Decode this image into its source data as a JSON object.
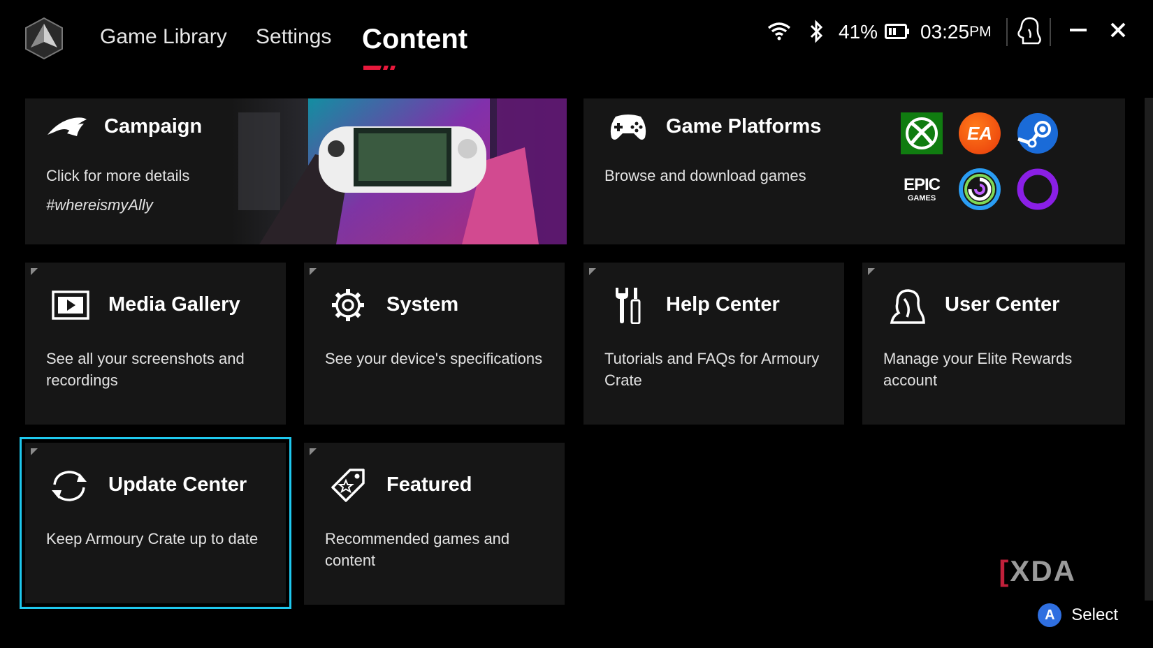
{
  "header": {
    "tabs": [
      {
        "label": "Game Library",
        "active": false
      },
      {
        "label": "Settings",
        "active": false
      },
      {
        "label": "Content",
        "active": true
      }
    ],
    "status": {
      "battery": "41%",
      "time": "03:25",
      "ampm": "PM"
    },
    "icons": [
      "rog-logo-icon",
      "wifi-icon",
      "bluetooth-icon",
      "battery-icon",
      "user-icon",
      "minimize-icon",
      "close-icon"
    ],
    "accent_color": "#e8193c"
  },
  "cards": {
    "campaign": {
      "title": "Campaign",
      "desc": "Click for more details",
      "hashtag": "#whereismyAlly",
      "icon": "rog-eye-icon"
    },
    "platforms": {
      "title": "Game Platforms",
      "desc": "Browse and download games",
      "icon": "gamepad-icon",
      "logos": {
        "xbox": "xbox-logo",
        "ea": "EA",
        "steam": "steam-logo",
        "epic_line1": "EPIC",
        "epic_line2": "GAMES",
        "ubisoft": "ubisoft-logo",
        "gog": "gog-logo"
      }
    },
    "media": {
      "title": "Media Gallery",
      "desc": "See all your screenshots and recordings",
      "icon": "media-icon"
    },
    "system": {
      "title": "System",
      "desc": "See your device's specifications",
      "icon": "gear-icon"
    },
    "help": {
      "title": "Help Center",
      "desc": "Tutorials and FAQs for Armoury Crate",
      "icon": "tools-icon"
    },
    "user": {
      "title": "User Center",
      "desc": "Manage your Elite Rewards account",
      "icon": "user-icon"
    },
    "update": {
      "title": "Update Center",
      "desc": "Keep Armoury Crate up to date",
      "icon": "refresh-icon",
      "selected": true
    },
    "featured": {
      "title": "Featured",
      "desc": "Recommended games and content",
      "icon": "tag-star-icon"
    }
  },
  "footer": {
    "select_button": "A",
    "select_label": "Select",
    "watermark": "XDA",
    "watermark_color": "#9a9a9a",
    "select_color": "#1ec8ee"
  }
}
